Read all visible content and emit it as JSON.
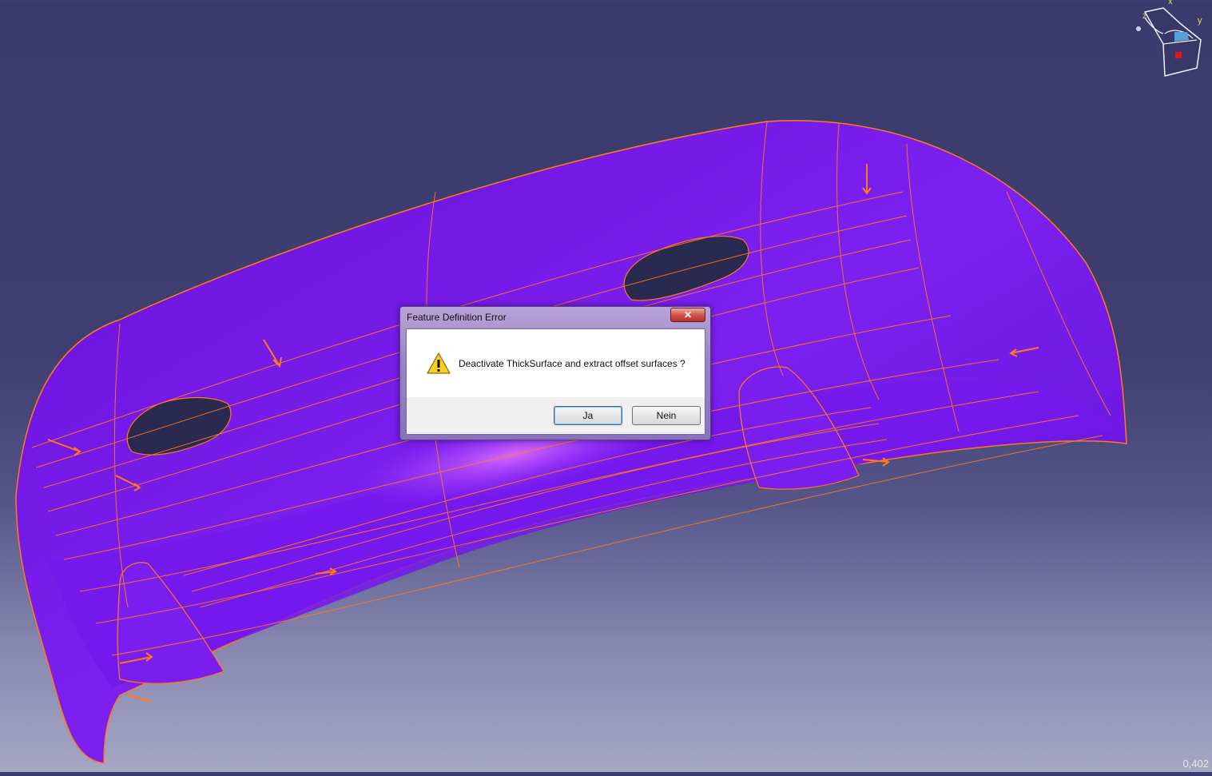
{
  "viewport": {
    "background_top": "#3b3b6e",
    "background_bottom": "#a6a6c4",
    "part_color": "#7a1ee8",
    "edge_color": "#ff7a1a",
    "zoom_readout": "0,402"
  },
  "compass": {
    "x_label": "x",
    "y_label": "y",
    "z_label": "z"
  },
  "dialog": {
    "title": "Feature Definition Error",
    "close_glyph": "✕",
    "icon": "warning-icon",
    "message": "Deactivate ThickSurface and extract offset surfaces ?",
    "yes_label": "Ja",
    "no_label": "Nein"
  }
}
